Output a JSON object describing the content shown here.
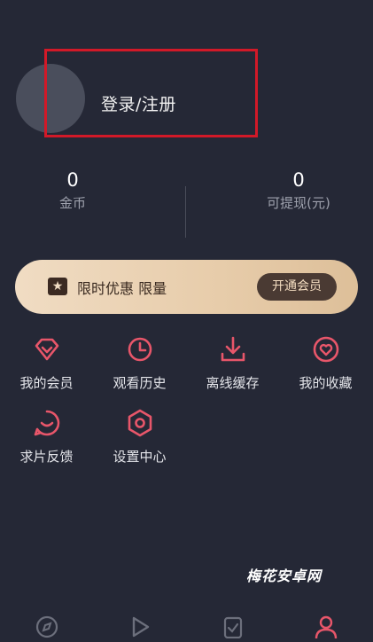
{
  "profile": {
    "login_label": "登录/注册"
  },
  "stats": {
    "coins_value": "0",
    "coins_label": "金币",
    "withdraw_value": "0",
    "withdraw_label": "可提现(元)"
  },
  "vip_banner": {
    "text": "限时优惠 限量",
    "button_label": "开通会员"
  },
  "menu": [
    {
      "label": "我的会员",
      "icon": "diamond-icon"
    },
    {
      "label": "观看历史",
      "icon": "clock-icon"
    },
    {
      "label": "离线缓存",
      "icon": "download-icon"
    },
    {
      "label": "我的收藏",
      "icon": "heart-icon"
    },
    {
      "label": "求片反馈",
      "icon": "feedback-icon"
    },
    {
      "label": "设置中心",
      "icon": "settings-icon"
    }
  ],
  "watermark": "梅花安卓网",
  "bottom_nav": [
    "compass-icon",
    "play-icon",
    "check-icon",
    "user-icon"
  ],
  "colors": {
    "background": "#252836",
    "accent": "#e8566a",
    "vip_gold": "#e7ccaa",
    "highlight_box": "#d21928"
  }
}
